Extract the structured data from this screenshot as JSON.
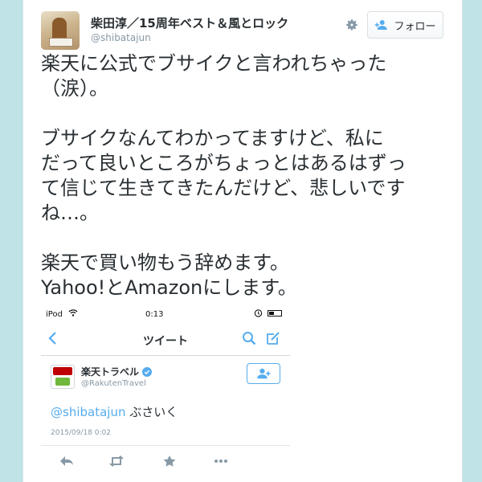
{
  "tweet": {
    "display_name": "柴田淳／15周年ベスト＆風とロック",
    "handle": "@shibatajun",
    "follow_label": "フォロー",
    "text_lines": [
      "楽天に公式でブサイクと言われちゃった",
      "（涙）。",
      "",
      "ブサイクなんてわかってますけど、私に",
      "だって良いところがちょっとはあるはずっ",
      "て信じて生きてきたんだけど、悲しいです",
      "ね…。",
      "",
      "楽天で買い物もう辞めます。",
      "Yahoo!とAmazonにします。"
    ]
  },
  "embedded_screenshot": {
    "status_bar": {
      "carrier": "iPod",
      "time": "0:13"
    },
    "nav_title": "ツイート",
    "account_name": "楽天トラベル",
    "account_handle": "@RakutenTravel",
    "mention": "@shibatajun",
    "reply_text": "ぶさいく",
    "timestamp": "2015/09/18 0:02"
  },
  "colors": {
    "page_background": "#bfe3e6",
    "accent_blue": "#55acee",
    "text": "#292f33",
    "muted": "#8899a6"
  },
  "icons": [
    "gear-icon",
    "follow-person-icon",
    "wifi-icon",
    "alarm-icon",
    "battery-icon",
    "back-chevron-icon",
    "search-icon",
    "compose-icon",
    "verified-badge-icon",
    "reply-icon",
    "retweet-icon",
    "favorite-icon",
    "more-icon"
  ]
}
